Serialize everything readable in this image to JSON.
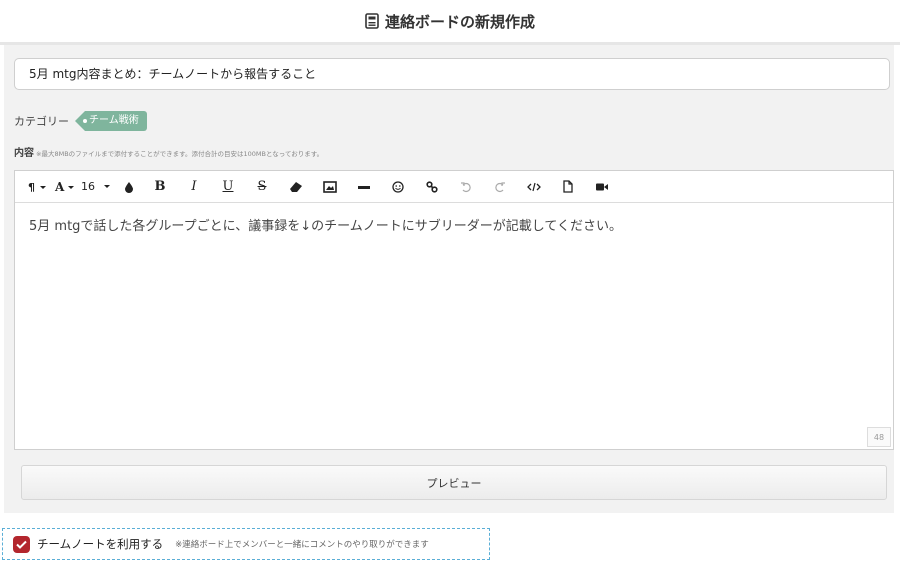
{
  "header": {
    "title": "連絡ボードの新規作成",
    "icon": "calculator-icon"
  },
  "form": {
    "title_value": "5月 mtg内容まとめ：チームノートから報告すること",
    "category_label": "カテゴリー",
    "category_tag": "チーム戦術",
    "content_label": "内容",
    "content_note": "※最大8MBのファイルまで添付することができます。添付合計の目安は100MBとなっております。"
  },
  "toolbar": {
    "font_size": "16",
    "items": [
      "paragraph-icon",
      "font-icon",
      "font-size",
      "color-drop-icon",
      "bold-icon",
      "italic-icon",
      "underline-icon",
      "strikethrough-icon",
      "eraser-icon",
      "image-icon",
      "hr-icon",
      "emoji-icon",
      "link-icon",
      "undo-icon",
      "redo-icon",
      "code-icon",
      "file-icon",
      "video-icon"
    ],
    "bold": "B",
    "italic": "I",
    "underline": "U",
    "strike": "S"
  },
  "editor": {
    "body_text": "5月 mtgで話した各グループごとに、議事録を↓のチームノートにサブリーダーが記載してください。",
    "char_count": "48"
  },
  "preview_button": "プレビュー",
  "teamnote": {
    "label": "チームノートを利用する",
    "note": "※連絡ボード上でメンバーと一緒にコメントのやり取りができます",
    "checked": true
  },
  "colors": {
    "tag": "#7fb59d",
    "checkbox": "#b3262d",
    "focus_border": "#5aaed6"
  }
}
